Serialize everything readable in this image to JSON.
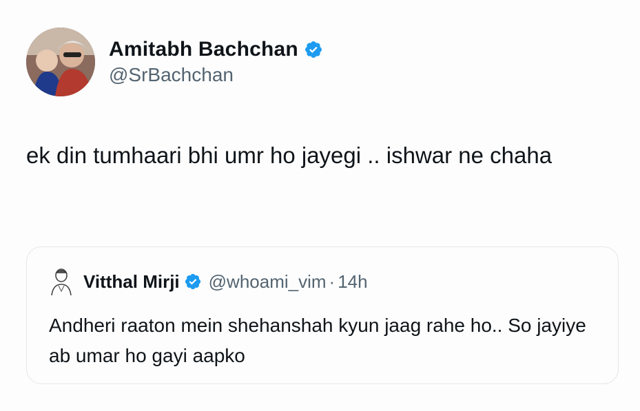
{
  "tweet": {
    "author": {
      "display_name": "Amitabh Bachchan",
      "handle": "@SrBachchan",
      "verified": true,
      "avatar_icon": "profile-photo"
    },
    "text": "ek din tumhaari bhi umr ho jayegi .. ishwar ne chaha"
  },
  "quoted_tweet": {
    "author": {
      "display_name": "Vitthal Mirji",
      "handle": "@whoami_vim",
      "verified": true,
      "avatar_icon": "sketch-avatar"
    },
    "separator": "·",
    "time": "14h",
    "text": "Andheri raaton mein shehanshah kyun jaag rahe ho.. So jayiye ab umar ho gayi aapko"
  },
  "colors": {
    "verified_blue": "#1d9bf0",
    "text_primary": "#0f1419",
    "text_secondary": "#536471",
    "card_border": "#e3e6e8"
  }
}
